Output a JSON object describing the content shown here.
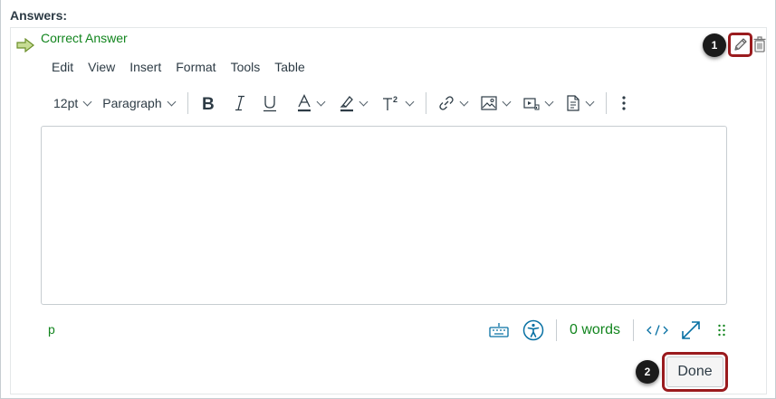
{
  "section_label": "Answers:",
  "answer": {
    "label": "Correct Answer",
    "status_color": "#12851e"
  },
  "icons": {
    "answer_arrow": "right-arrow-icon",
    "edit": "pencil-icon",
    "delete": "trash-icon"
  },
  "callouts": [
    "1",
    "2"
  ],
  "highlight_color": "#9a1b1e",
  "editor": {
    "menu": [
      "Edit",
      "View",
      "Insert",
      "Format",
      "Tools",
      "Table"
    ],
    "font_size": "12pt",
    "block_format": "Paragraph",
    "toolbar_icons": [
      "bold-icon",
      "italic-icon",
      "underline-icon",
      "text-color-icon",
      "highlight-color-icon",
      "superscript-icon",
      "link-icon",
      "image-icon",
      "media-icon",
      "document-icon",
      "more-icon"
    ],
    "body_text": "",
    "status": {
      "element_path": "p",
      "word_count": "0 words",
      "status_icons": [
        "keyboard-icon",
        "accessibility-icon",
        "html-code-icon",
        "fullscreen-icon",
        "resize-handle-icon"
      ]
    }
  },
  "done_button": "Done"
}
